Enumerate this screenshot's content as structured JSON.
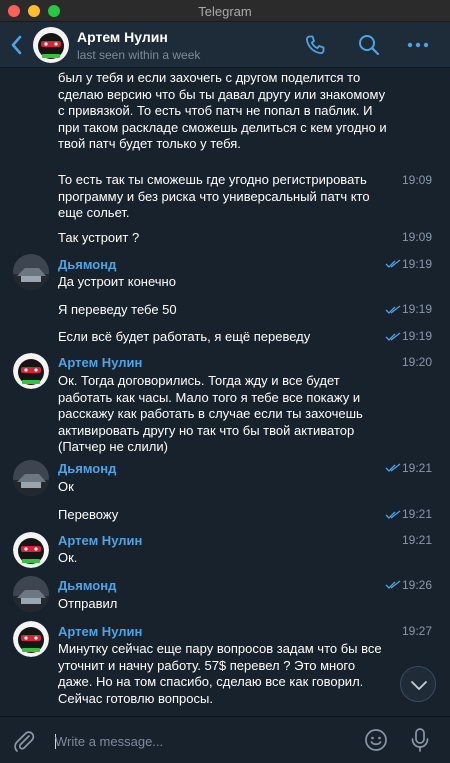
{
  "window": {
    "title": "Telegram"
  },
  "header": {
    "name": "Артем Нулин",
    "status": "last seen within a week",
    "icons": [
      "back-icon",
      "phone-icon",
      "search-icon",
      "more-icon"
    ]
  },
  "messages": [
    {
      "text": "был у тебя и если захочегь с другом поделится то сделаю версию что бы ты давал другу или знакомому с привязкой. То есть чтоб патч не попал в паблик. И при таком раскладе сможешь делиться с кем угодно и твой патч будет только у тебя.",
      "time": ""
    },
    {
      "text": "То есть так ты сможешь где угодно регистрировать программу и без риска что универсальный патч кто еще сольет.",
      "time": "19:09"
    },
    {
      "text": "Так устроит ?",
      "time": "19:09"
    },
    {
      "sender": "Дьямонд",
      "text": "Да устроит конечно",
      "time": "19:19",
      "read": true
    },
    {
      "text": "Я переведу тебе 50",
      "time": "19:19",
      "read": true
    },
    {
      "text": "Если всё будет работать, я ещё переведу",
      "time": "19:19",
      "read": true
    },
    {
      "sender": "Артем Нулин",
      "text": "Ок. Тогда договорились. Тогда жду и все будет работать как часы. Мало того я тебе все покажу и расскажу как работать в случае если ты захочешь активировать другу но так что бы твой активатор (Патчер не слили)",
      "time": "19:20"
    },
    {
      "sender": "Дьямонд",
      "text": "Ок",
      "time": "19:21",
      "read": true
    },
    {
      "text": "Перевожу",
      "time": "19:21",
      "read": true
    },
    {
      "sender": "Артем Нулин",
      "text": "Ок.",
      "time": "19:21"
    },
    {
      "sender": "Дьямонд",
      "text": "Отправил",
      "time": "19:26",
      "read": true
    },
    {
      "sender": "Артем Нулин",
      "text": "Минутку сейчас еще пару вопросов задам что бы все уточнит и начну работу. 57$ перевел ? Это много даже. Но на том спасибо, сделаю все как говорил. Сейчас готовлю вопросы.",
      "time": "19:27"
    }
  ],
  "composer": {
    "placeholder": "Write a message...",
    "icons": [
      "attach-icon",
      "emoji-icon",
      "microphone-icon"
    ]
  },
  "colors": {
    "background": "#18222d",
    "header": "#1e2b38",
    "accent": "#4fa3e3",
    "secondary_text": "#8a98a6"
  }
}
